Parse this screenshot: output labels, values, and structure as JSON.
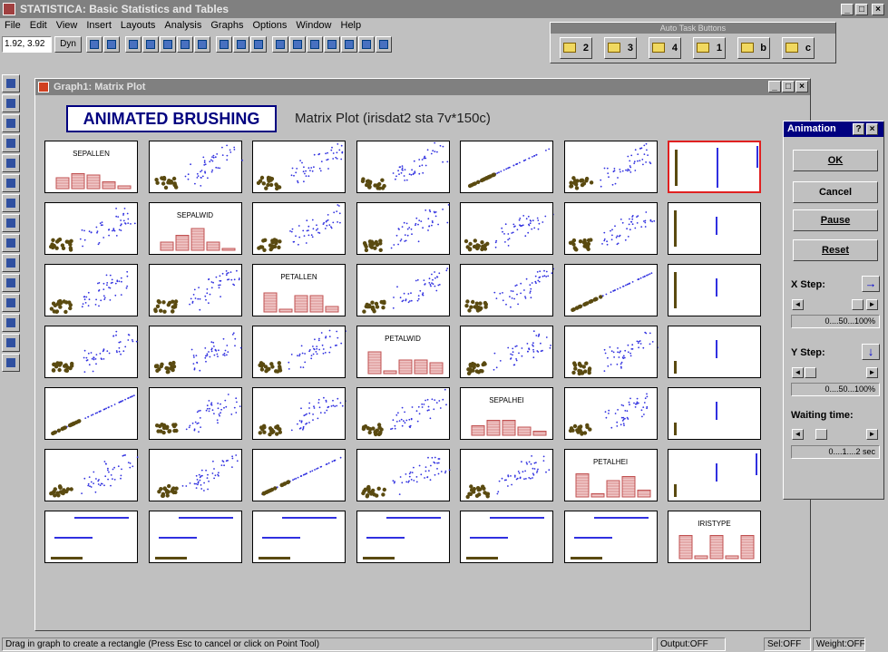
{
  "window": {
    "title": "STATISTICA: Basic Statistics and Tables"
  },
  "menu": [
    "File",
    "Edit",
    "View",
    "Insert",
    "Layouts",
    "Analysis",
    "Graphs",
    "Options",
    "Window",
    "Help"
  ],
  "toolbar": {
    "coords": "1.92, 3.92",
    "dyn_label": "Dyn"
  },
  "auto_task": {
    "title": "Auto Task Buttons",
    "buttons": [
      "2",
      "3",
      "4",
      "1",
      "b",
      "c"
    ]
  },
  "graph_window": {
    "title": "Graph1: Matrix Plot",
    "banner": "ANIMATED BRUSHING",
    "subtitle": "Matrix Plot (irisdat2 sta 7v*150c)"
  },
  "matrix": {
    "variables": [
      "SEPALLEN",
      "SEPALWID",
      "PETALLEN",
      "PETALWID",
      "SEPALHEI",
      "PETALHEI",
      "IRISTYPE"
    ],
    "highlight_color": "#e02020",
    "brushed_color": "#5a4a10",
    "point_color": "#3030e0",
    "hist_color": "#c05050"
  },
  "animation": {
    "title": "Animation",
    "ok": "OK",
    "cancel": "Cancel",
    "pause": "Pause",
    "reset": "Reset",
    "x_step_label": "X Step:",
    "x_scale": "0....50...100%",
    "y_step_label": "Y Step:",
    "y_scale": "0....50...100%",
    "wait_label": "Waiting time:",
    "wait_scale": "0....1....2 sec"
  },
  "status": {
    "message": "Drag in graph to create a rectangle (Press Esc to cancel or click on Point Tool)",
    "output": "Output:OFF",
    "sel": "Sel:OFF",
    "weight": "Weight:OFF"
  }
}
